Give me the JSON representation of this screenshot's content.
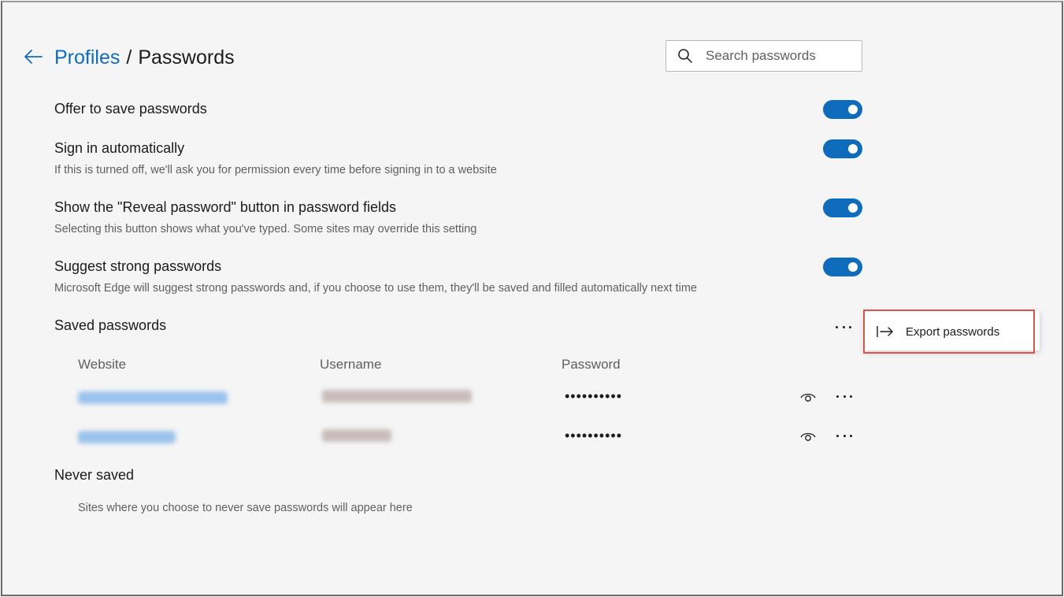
{
  "header": {
    "breadcrumb_parent": "Profiles",
    "breadcrumb_separator": "/",
    "breadcrumb_current": "Passwords",
    "search_placeholder": "Search passwords"
  },
  "settings": [
    {
      "title": "Offer to save passwords",
      "description": "",
      "enabled": true
    },
    {
      "title": "Sign in automatically",
      "description": "If this is turned off, we'll ask you for permission every time before signing in to a website",
      "enabled": true
    },
    {
      "title": "Show the \"Reveal password\" button in password fields",
      "description": "Selecting this button shows what you've typed. Some sites may override this setting",
      "enabled": true
    },
    {
      "title": "Suggest strong passwords",
      "description": "Microsoft Edge will suggest strong passwords and, if you choose to use them, they'll be saved and filled automatically next time",
      "enabled": true
    }
  ],
  "saved_passwords": {
    "title": "Saved passwords",
    "menu": {
      "export_label": "Export passwords"
    },
    "columns": [
      "Website",
      "Username",
      "Password"
    ],
    "rows": [
      {
        "password_mask": "••••••••••"
      },
      {
        "password_mask": "••••••••••"
      }
    ]
  },
  "never_saved": {
    "title": "Never saved",
    "empty_text": "Sites where you choose to never save passwords will appear here"
  },
  "colors": {
    "accent": "#0f6cbd",
    "highlight_border": "#d9534f",
    "background": "#f5f5f5"
  },
  "icons": [
    "back-arrow-icon",
    "search-icon",
    "more-icon",
    "export-icon",
    "eye-icon"
  ]
}
